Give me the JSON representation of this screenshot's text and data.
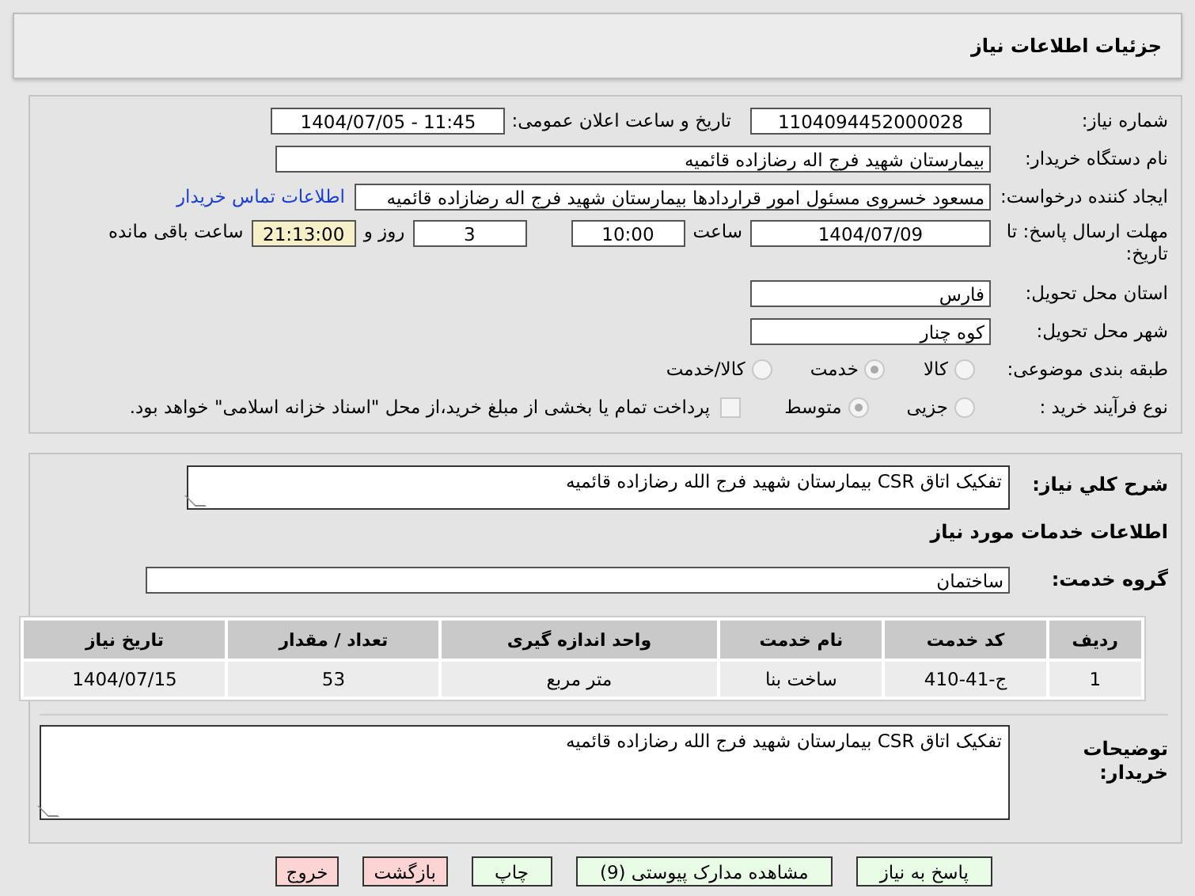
{
  "header": {
    "title": "جزئیات اطلاعات نیاز"
  },
  "info": {
    "need_number": {
      "label": "شماره نیاز:",
      "value": "1104094452000028"
    },
    "announce": {
      "label": "تاریخ و ساعت اعلان عمومی:",
      "value": "1404/07/05 - 11:45"
    },
    "buyer": {
      "label": "نام دستگاه خریدار:",
      "value": "بیمارستان شهید فرج اله رضازاده قائمیه"
    },
    "requester": {
      "label": "ایجاد کننده درخواست:",
      "value": "مسعود خسروی مسئول امور قراردادها بیمارستان شهید فرج اله رضازاده قائمیه",
      "link": "اطلاعات تماس خریدار"
    },
    "deadline": {
      "label": "مهلت ارسال پاسخ: تا تاریخ:",
      "date": "1404/07/09",
      "time_label": "ساعت",
      "time": "10:00",
      "days": "3",
      "days_label": "روز و",
      "remaining": "21:13:00",
      "remaining_label": "ساعت باقی مانده"
    },
    "province": {
      "label": "استان محل تحویل:",
      "value": "فارس"
    },
    "city": {
      "label": "شهر محل تحویل:",
      "value": "کوه چنار"
    },
    "category": {
      "label": "طبقه بندی موضوعی:",
      "options": [
        {
          "label": "کالا",
          "selected": false
        },
        {
          "label": "خدمت",
          "selected": true
        },
        {
          "label": "کالا/خدمت",
          "selected": false
        }
      ]
    },
    "purchase_type": {
      "label": "نوع فرآیند خرید :",
      "options": [
        {
          "label": "جزیی",
          "selected": false
        },
        {
          "label": "متوسط",
          "selected": true
        }
      ],
      "payment": {
        "label": "پرداخت تمام یا بخشی از مبلغ خرید،از محل \"اسناد خزانه اسلامی\" خواهد بود.",
        "checked": false
      }
    }
  },
  "details": {
    "description": {
      "label": "شرح کلي نياز:",
      "value": "تفکیک اتاق CSR بیمارستان شهید فرج الله رضازاده قائمیه"
    },
    "services_title": "اطلاعات خدمات مورد نیاز",
    "service_group": {
      "label": "گروه خدمت:",
      "value": "ساختمان"
    },
    "table": {
      "columns": [
        "ردیف",
        "کد خدمت",
        "نام خدمت",
        "واحد اندازه گیری",
        "تعداد / مقدار",
        "تاریخ نیاز"
      ],
      "rows": [
        [
          "1",
          "ج-41-410",
          "ساخت بنا",
          "متر مربع",
          "53",
          "1404/07/15"
        ]
      ]
    },
    "buyer_notes": {
      "label": "توضیحات خریدار:",
      "value": "تفکیک اتاق CSR بیمارستان شهید فرج الله رضازاده قائمیه"
    }
  },
  "buttons": [
    {
      "label": "پاسخ به نیاز",
      "kind": "action"
    },
    {
      "label": "مشاهده مدارک پیوستی (9)",
      "kind": "action"
    },
    {
      "label": "چاپ",
      "kind": "action"
    },
    {
      "label": "بازگشت",
      "kind": "exit"
    },
    {
      "label": "خروج",
      "kind": "exit"
    }
  ]
}
